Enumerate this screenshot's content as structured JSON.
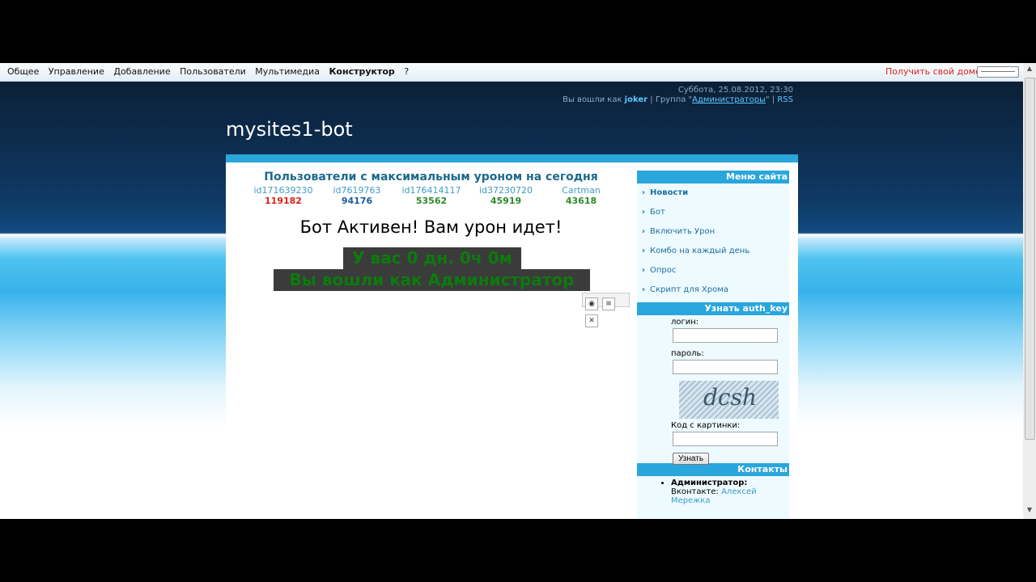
{
  "topbar": {
    "nav": [
      "Общее",
      "Управление",
      "Добавление",
      "Пользователи",
      "Мультимедиа",
      "Конструктор",
      "?"
    ],
    "active": "Конструктор",
    "domain_link": "Получить свой домен"
  },
  "header": {
    "datetime": "Суббота, 25.08.2012, 23:30",
    "logged_in_prefix": "Вы вошли как",
    "username": "joker",
    "group_prefix": "| Группа \"",
    "group_name": "Администраторы",
    "group_suffix": "\" |",
    "rss": "RSS",
    "site_title": "mysites1-bot"
  },
  "top_users": {
    "title": "Пользователи с максимальным уроном на сегодня",
    "users": [
      {
        "name": "id171639230",
        "damage": "119182",
        "color": "#d8201c"
      },
      {
        "name": "id7619763",
        "damage": "94176",
        "color": "#1c5a9c"
      },
      {
        "name": "id176414117",
        "damage": "53562",
        "color": "#2c8a2a"
      },
      {
        "name": "id37230720",
        "damage": "45919",
        "color": "#2c8a2a"
      },
      {
        "name": "Cartman",
        "damage": "43618",
        "color": "#2c8a2a"
      }
    ]
  },
  "status": {
    "bot_active": "Бот Активен! Вам урон идет!",
    "time_left": "У вас 0 дн. 0ч 0м",
    "admin_msg": "Вы вошли как Администратор"
  },
  "sidebar": {
    "menu_title": "Меню сайта",
    "menu_items": [
      "Новости",
      "Бот",
      "Включить Урон",
      "Комбо на каждый день",
      "Опрос",
      "Скрипт для Хрома"
    ],
    "auth_title": "Узнать auth_key",
    "login_label": "логин:",
    "password_label": "пароль:",
    "captcha_text": "dcsh",
    "captcha_label": "Код с картинки:",
    "submit_label": "Узнать",
    "contacts_title": "Контакты",
    "admin_label": "Администратор:",
    "vk_prefix": "Вконтакте:",
    "vk_name": "Алексей Мережка"
  },
  "icons": [
    "eye-icon",
    "edit-icon",
    "close-icon",
    "scroll-up-icon",
    "scroll-down-icon"
  ]
}
